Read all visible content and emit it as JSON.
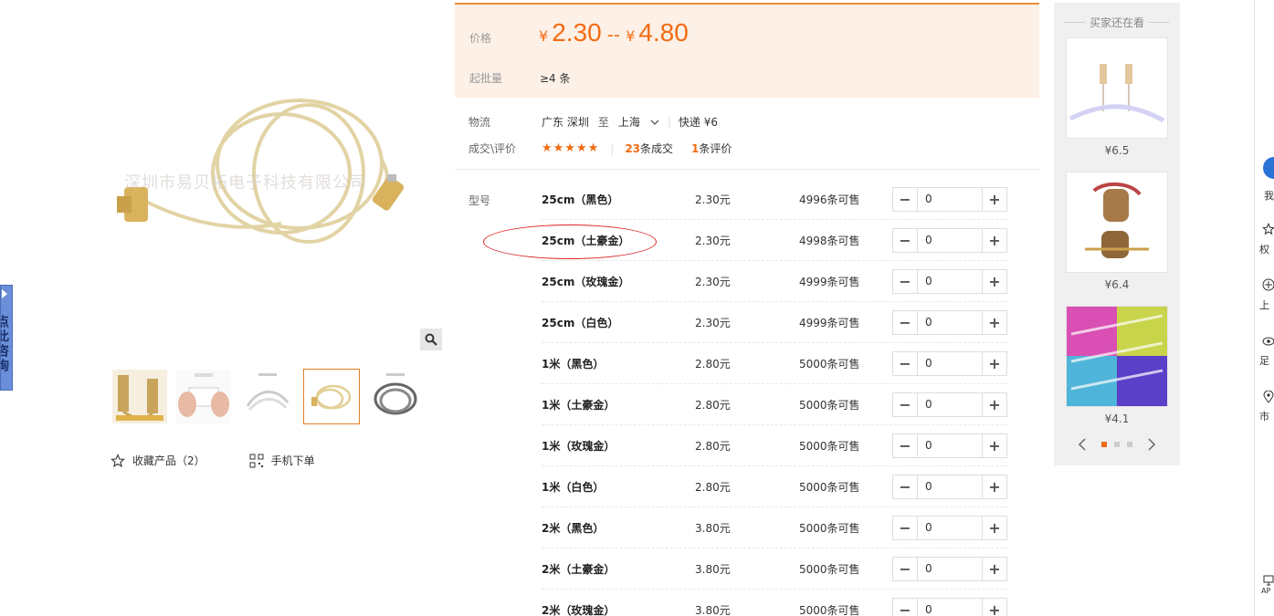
{
  "left_tab": {
    "label": "点此咨询"
  },
  "product": {
    "watermark": "深圳市易贝拓电子科技有限公司",
    "thumbnail_count": 5,
    "active_thumbnail": 3,
    "actions": {
      "favorite_label": "收藏产品（2）",
      "mobile_order_label": "手机下单"
    }
  },
  "price": {
    "label": "价格",
    "currency": "¥",
    "low": "2.30",
    "separator": "--",
    "high": "4.80",
    "moq_label": "起批量",
    "moq_value": "≥4 条"
  },
  "logistics": {
    "label": "物流",
    "from": "广东 深圳",
    "to_word": "至",
    "to": "上海",
    "method": "快递 ¥6"
  },
  "deals": {
    "label": "成交\\评价",
    "stars": "★★★★★",
    "deal_count": "23",
    "deal_suffix": "条成交",
    "review_count": "1",
    "review_suffix": "条评价"
  },
  "sku": {
    "label": "型号",
    "rows": [
      {
        "name": "25cm（黑色）",
        "price": "2.30元",
        "stock": "4996条可售",
        "qty": "0"
      },
      {
        "name": "25cm（土豪金）",
        "price": "2.30元",
        "stock": "4998条可售",
        "qty": "0"
      },
      {
        "name": "25cm（玫瑰金）",
        "price": "2.30元",
        "stock": "4999条可售",
        "qty": "0"
      },
      {
        "name": "25cm（白色）",
        "price": "2.30元",
        "stock": "4999条可售",
        "qty": "0"
      },
      {
        "name": "1米（黑色）",
        "price": "2.80元",
        "stock": "5000条可售",
        "qty": "0"
      },
      {
        "name": "1米（土豪金）",
        "price": "2.80元",
        "stock": "5000条可售",
        "qty": "0"
      },
      {
        "name": "1米（玫瑰金）",
        "price": "2.80元",
        "stock": "5000条可售",
        "qty": "0"
      },
      {
        "name": "1米（白色）",
        "price": "2.80元",
        "stock": "5000条可售",
        "qty": "0"
      },
      {
        "name": "2米（黑色）",
        "price": "3.80元",
        "stock": "5000条可售",
        "qty": "0"
      },
      {
        "name": "2米（土豪金）",
        "price": "3.80元",
        "stock": "5000条可售",
        "qty": "0"
      },
      {
        "name": "2米（玫瑰金）",
        "price": "3.80元",
        "stock": "5000条可售",
        "qty": "0"
      }
    ]
  },
  "recommend": {
    "title": "买家还在看",
    "items": [
      {
        "price": "¥6.5"
      },
      {
        "price": "¥6.4"
      },
      {
        "price": "¥4.1"
      }
    ]
  },
  "right_bar": {
    "items": [
      "我",
      "权",
      "上",
      "足",
      "市",
      "AP"
    ]
  },
  "colors": {
    "accent": "#f26b13",
    "price_bg": "#fdf0e6",
    "annotation": "#dd2222"
  }
}
